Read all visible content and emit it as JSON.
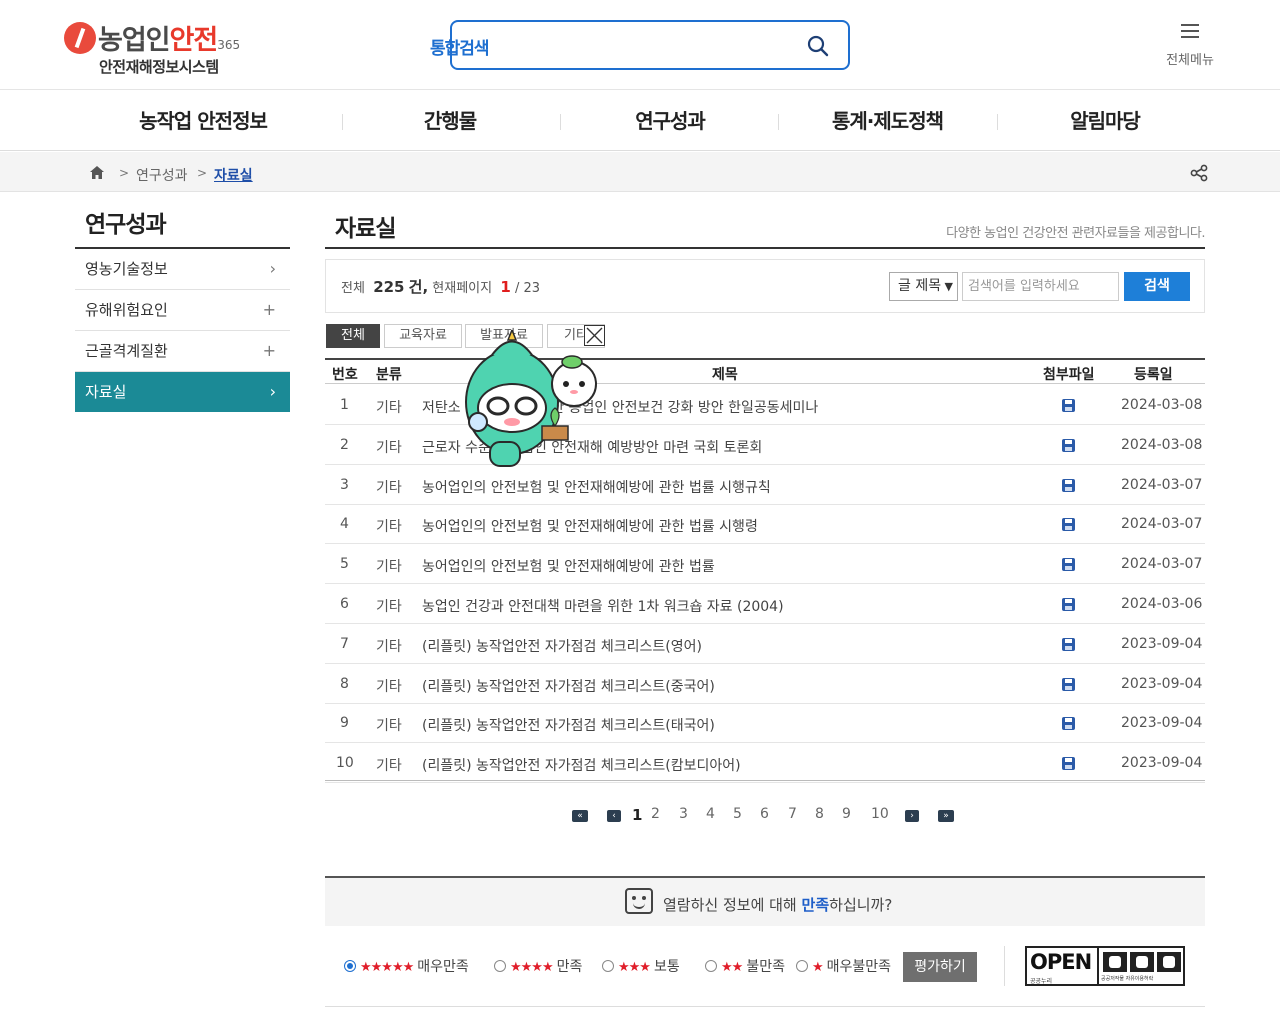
{
  "header": {
    "logo_prefix": "농업인",
    "logo_accent": "안전",
    "logo_sup": "365",
    "logo_subtitle": "안전재해정보시스템",
    "search_label": "통합검색",
    "search_value": "",
    "all_menu_label": "전체메뉴"
  },
  "gnb": [
    "농작업 안전정보",
    "간행물",
    "연구성과",
    "통계·제도정책",
    "알림마당"
  ],
  "breadcrumb": {
    "level1": "연구성과",
    "current": "자료실"
  },
  "lnb": {
    "title": "연구성과",
    "items": [
      {
        "label": "영농기술정보",
        "mark": "›"
      },
      {
        "label": "유해위험요인",
        "mark": "+"
      },
      {
        "label": "근골격계질환",
        "mark": "+"
      },
      {
        "label": "자료실",
        "mark": "›"
      }
    ]
  },
  "content": {
    "title": "자료실",
    "description": "다양한 농업인 건강안전 관련자료들을 제공합니다.",
    "count": {
      "total_label": "전체",
      "total": "225",
      "unit": "건,",
      "page_label": "현재페이지",
      "current_page": "1",
      "total_pages": "/ 23"
    },
    "search_select": "글 제목",
    "search_placeholder": "검색어를 입력하세요",
    "search_button": "검색",
    "tabs": [
      "전체",
      "교육자료",
      "발표자료",
      "기타"
    ],
    "table": {
      "headers": [
        "번호",
        "분류",
        "제목",
        "첨부파일",
        "등록일"
      ],
      "rows": [
        {
          "no": "1",
          "cat": "기타",
          "title": "저탄소 농업 실현을 위한 농업인 안전보건 강화 방안 한일공동세미나",
          "date": "2024-03-08"
        },
        {
          "no": "2",
          "cat": "기타",
          "title": "근로자 수준의 농업인 안전재해 예방방안 마련 국회 토론회",
          "date": "2024-03-08"
        },
        {
          "no": "3",
          "cat": "기타",
          "title": "농어업인의 안전보험 및 안전재해예방에 관한 법률 시행규칙",
          "date": "2024-03-07"
        },
        {
          "no": "4",
          "cat": "기타",
          "title": "농어업인의 안전보험 및 안전재해예방에 관한 법률 시행령",
          "date": "2024-03-07"
        },
        {
          "no": "5",
          "cat": "기타",
          "title": "농어업인의 안전보험 및 안전재해예방에 관한 법률",
          "date": "2024-03-07"
        },
        {
          "no": "6",
          "cat": "기타",
          "title": "농업인 건강과 안전대책 마련을 위한 1차 워크숍 자료 (2004)",
          "date": "2024-03-06"
        },
        {
          "no": "7",
          "cat": "기타",
          "title": "(리플릿) 농작업안전 자가점검 체크리스트(영어)",
          "date": "2023-09-04"
        },
        {
          "no": "8",
          "cat": "기타",
          "title": "(리플릿) 농작업안전 자가점검 체크리스트(중국어)",
          "date": "2023-09-04"
        },
        {
          "no": "9",
          "cat": "기타",
          "title": "(리플릿) 농작업안전 자가점검 체크리스트(태국어)",
          "date": "2023-09-04"
        },
        {
          "no": "10",
          "cat": "기타",
          "title": "(리플릿) 농작업안전 자가점검 체크리스트(캄보디아어)",
          "date": "2023-09-04"
        }
      ]
    },
    "pagination": {
      "pages": [
        "1",
        "2",
        "3",
        "4",
        "5",
        "6",
        "7",
        "8",
        "9",
        "10"
      ],
      "current": "1"
    }
  },
  "satisfaction": {
    "question_pre": "열람하신 정보에 대해",
    "question_em": "만족",
    "question_post": "하십니까?",
    "options": [
      {
        "stars": "★★★★★",
        "label": "매우만족",
        "selected": true
      },
      {
        "stars": "★★★★",
        "label": "만족",
        "selected": false
      },
      {
        "stars": "★★★",
        "label": "보통",
        "selected": false
      },
      {
        "stars": "★★",
        "label": "불만족",
        "selected": false
      },
      {
        "stars": "★",
        "label": "매우불만족",
        "selected": false
      }
    ],
    "submit": "평가하기"
  },
  "open_badge": {
    "text": "OPEN",
    "sub": "공공누리",
    "sub2": "공공저작물 자유이용허락"
  },
  "colors": {
    "accent_blue": "#1e6fd0",
    "lnb_active": "#1b8a96",
    "logo_red": "#e8392b",
    "star_red": "#e01e2a"
  }
}
